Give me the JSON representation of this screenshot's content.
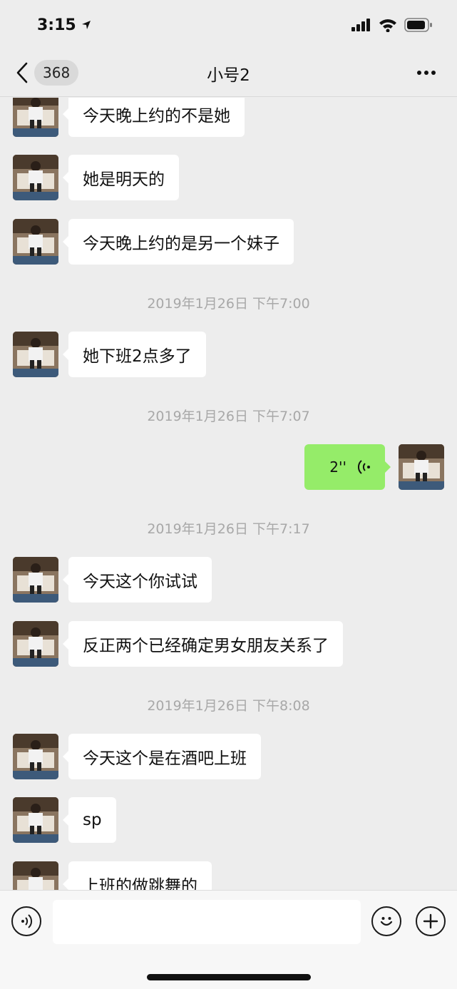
{
  "status_bar": {
    "time": "3:15"
  },
  "nav": {
    "back_count": "368",
    "title": "小号2"
  },
  "messages": [
    {
      "type": "text",
      "side": "left",
      "text": "今天晚上约的不是她"
    },
    {
      "type": "text",
      "side": "left",
      "text": "她是明天的"
    },
    {
      "type": "text",
      "side": "left",
      "text": "今天晚上约的是另一个妹子"
    },
    {
      "type": "time",
      "text": "2019年1月26日 下午7:00"
    },
    {
      "type": "text",
      "side": "left",
      "text": "她下班2点多了"
    },
    {
      "type": "time",
      "text": "2019年1月26日 下午7:07"
    },
    {
      "type": "voice",
      "side": "right",
      "text": "2''"
    },
    {
      "type": "time",
      "text": "2019年1月26日 下午7:17"
    },
    {
      "type": "text",
      "side": "left",
      "text": "今天这个你试试"
    },
    {
      "type": "text",
      "side": "left",
      "text": "反正两个已经确定男女朋友关系了"
    },
    {
      "type": "time",
      "text": "2019年1月26日 下午8:08"
    },
    {
      "type": "text",
      "side": "left",
      "text": "今天这个是在酒吧上班"
    },
    {
      "type": "text",
      "side": "left",
      "text": "sp"
    },
    {
      "type": "text",
      "side": "left",
      "text": "上班的做跳舞的"
    }
  ],
  "input_bar": {
    "voice_icon": "voice-toggle-icon",
    "emoji_icon": "emoji-icon",
    "plus_icon": "plus-icon",
    "text_value": ""
  },
  "colors": {
    "background": "#ededed",
    "own_bubble": "#95ec69",
    "other_bubble": "#ffffff",
    "timestamp": "#a8a8a8"
  }
}
